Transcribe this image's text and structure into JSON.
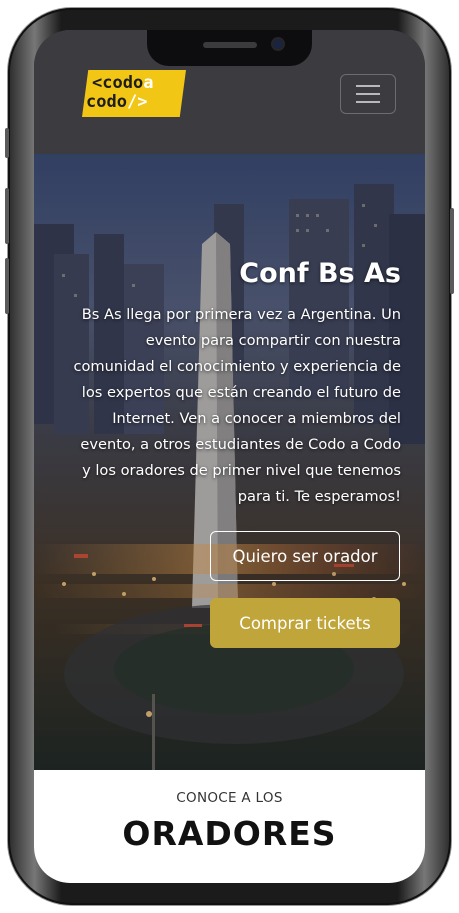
{
  "navbar": {
    "logo": {
      "line1_a": "<codo",
      "line1_b": "a",
      "line2_a": "codo",
      "line2_b": "/>"
    },
    "menu_icon": "hamburger-icon"
  },
  "hero": {
    "title": "Conf Bs As",
    "description": "Bs As llega por primera vez a Argentina. Un evento para compartir con nuestra comunidad el conocimiento y experiencia de los expertos que están creando el futuro de Internet. Ven a conocer a miembros del evento, a otros estudiantes de Codo a Codo y los oradores de primer nivel que tenemos para ti. Te esperamos!",
    "primary_button": "Quiero ser orador",
    "secondary_button": "Comprar tickets"
  },
  "speakers_section": {
    "subtitle": "CONOCE A LOS",
    "title": "ORADORES"
  },
  "colors": {
    "navbar_bg": "#3b3b40",
    "logo_yellow": "#f2c614",
    "tickets_button": "#c0a53a"
  }
}
